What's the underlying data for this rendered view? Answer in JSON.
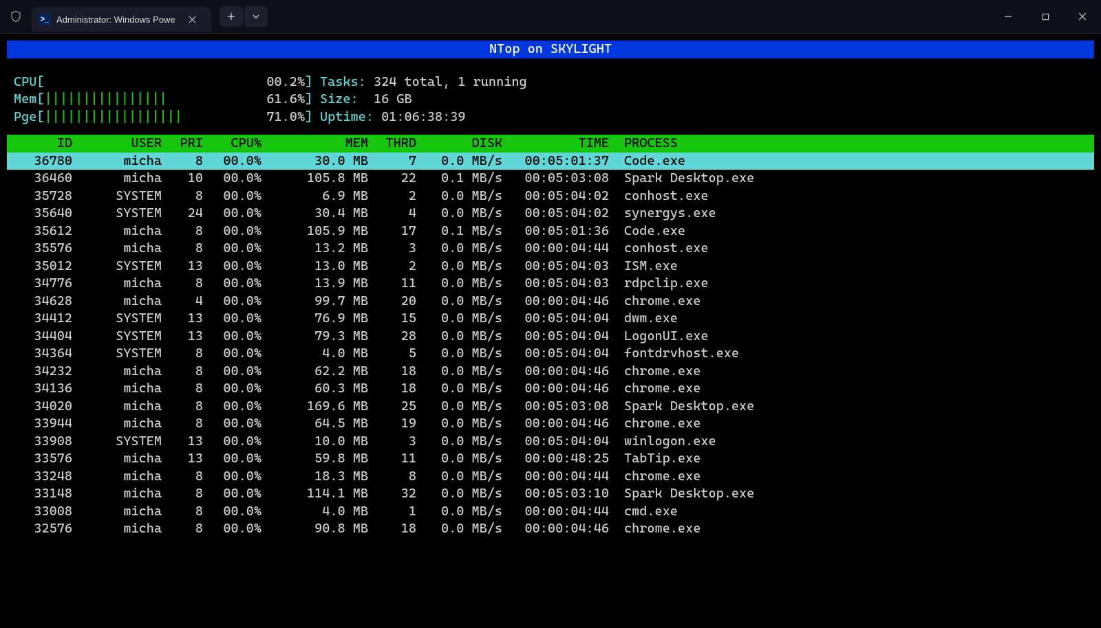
{
  "window": {
    "tab_title": "Administrator: Windows Powe"
  },
  "banner_text": "NTop on SKYLIGHT",
  "meters": {
    "cpu": {
      "label": "CPU",
      "bars": "",
      "pct": "00.2%"
    },
    "mem": {
      "label": "Mem",
      "bars": "||||||||||||||||",
      "pct": "61.6%"
    },
    "pge": {
      "label": "Pge",
      "bars": "||||||||||||||||||",
      "pct": "71.0%"
    }
  },
  "stats": {
    "tasks_label": "Tasks:",
    "tasks_value": "324 total, 1 running",
    "size_label": "Size:",
    "size_value": "16 GB",
    "uptime_label": "Uptime:",
    "uptime_value": "01:06:38:39"
  },
  "columns": {
    "id": "ID",
    "user": "USER",
    "pri": "PRI",
    "cpu": "CPU%",
    "mem": "MEM",
    "thrd": "THRD",
    "disk": "DISK",
    "time": "TIME",
    "process": "PROCESS"
  },
  "rows": [
    {
      "id": "36780",
      "user": "micha",
      "pri": "8",
      "cpu": "00.0%",
      "mem": "30.0 MB",
      "thrd": "7",
      "disk": "0.0 MB/s",
      "time": "00:05:01:37",
      "proc": "Code.exe",
      "selected": true
    },
    {
      "id": "36460",
      "user": "micha",
      "pri": "10",
      "cpu": "00.0%",
      "mem": "105.8 MB",
      "thrd": "22",
      "disk": "0.1 MB/s",
      "time": "00:05:03:08",
      "proc": "Spark Desktop.exe"
    },
    {
      "id": "35728",
      "user": "SYSTEM",
      "pri": "8",
      "cpu": "00.0%",
      "mem": "6.9 MB",
      "thrd": "2",
      "disk": "0.0 MB/s",
      "time": "00:05:04:02",
      "proc": "conhost.exe"
    },
    {
      "id": "35640",
      "user": "SYSTEM",
      "pri": "24",
      "cpu": "00.0%",
      "mem": "30.4 MB",
      "thrd": "4",
      "disk": "0.0 MB/s",
      "time": "00:05:04:02",
      "proc": "synergys.exe"
    },
    {
      "id": "35612",
      "user": "micha",
      "pri": "8",
      "cpu": "00.0%",
      "mem": "105.9 MB",
      "thrd": "17",
      "disk": "0.1 MB/s",
      "time": "00:05:01:36",
      "proc": "Code.exe"
    },
    {
      "id": "35576",
      "user": "micha",
      "pri": "8",
      "cpu": "00.0%",
      "mem": "13.2 MB",
      "thrd": "3",
      "disk": "0.0 MB/s",
      "time": "00:00:04:44",
      "proc": "conhost.exe"
    },
    {
      "id": "35012",
      "user": "SYSTEM",
      "pri": "13",
      "cpu": "00.0%",
      "mem": "13.0 MB",
      "thrd": "2",
      "disk": "0.0 MB/s",
      "time": "00:05:04:03",
      "proc": "ISM.exe"
    },
    {
      "id": "34776",
      "user": "micha",
      "pri": "8",
      "cpu": "00.0%",
      "mem": "13.9 MB",
      "thrd": "11",
      "disk": "0.0 MB/s",
      "time": "00:05:04:03",
      "proc": "rdpclip.exe"
    },
    {
      "id": "34628",
      "user": "micha",
      "pri": "4",
      "cpu": "00.0%",
      "mem": "99.7 MB",
      "thrd": "20",
      "disk": "0.0 MB/s",
      "time": "00:00:04:46",
      "proc": "chrome.exe"
    },
    {
      "id": "34412",
      "user": "SYSTEM",
      "pri": "13",
      "cpu": "00.0%",
      "mem": "76.9 MB",
      "thrd": "15",
      "disk": "0.0 MB/s",
      "time": "00:05:04:04",
      "proc": "dwm.exe"
    },
    {
      "id": "34404",
      "user": "SYSTEM",
      "pri": "13",
      "cpu": "00.0%",
      "mem": "79.3 MB",
      "thrd": "28",
      "disk": "0.0 MB/s",
      "time": "00:05:04:04",
      "proc": "LogonUI.exe"
    },
    {
      "id": "34364",
      "user": "SYSTEM",
      "pri": "8",
      "cpu": "00.0%",
      "mem": "4.0 MB",
      "thrd": "5",
      "disk": "0.0 MB/s",
      "time": "00:05:04:04",
      "proc": "fontdrvhost.exe"
    },
    {
      "id": "34232",
      "user": "micha",
      "pri": "8",
      "cpu": "00.0%",
      "mem": "62.2 MB",
      "thrd": "18",
      "disk": "0.0 MB/s",
      "time": "00:00:04:46",
      "proc": "chrome.exe"
    },
    {
      "id": "34136",
      "user": "micha",
      "pri": "8",
      "cpu": "00.0%",
      "mem": "60.3 MB",
      "thrd": "18",
      "disk": "0.0 MB/s",
      "time": "00:00:04:46",
      "proc": "chrome.exe"
    },
    {
      "id": "34020",
      "user": "micha",
      "pri": "8",
      "cpu": "00.0%",
      "mem": "169.6 MB",
      "thrd": "25",
      "disk": "0.0 MB/s",
      "time": "00:05:03:08",
      "proc": "Spark Desktop.exe"
    },
    {
      "id": "33944",
      "user": "micha",
      "pri": "8",
      "cpu": "00.0%",
      "mem": "64.5 MB",
      "thrd": "19",
      "disk": "0.0 MB/s",
      "time": "00:00:04:46",
      "proc": "chrome.exe"
    },
    {
      "id": "33908",
      "user": "SYSTEM",
      "pri": "13",
      "cpu": "00.0%",
      "mem": "10.0 MB",
      "thrd": "3",
      "disk": "0.0 MB/s",
      "time": "00:05:04:04",
      "proc": "winlogon.exe"
    },
    {
      "id": "33576",
      "user": "micha",
      "pri": "13",
      "cpu": "00.0%",
      "mem": "59.8 MB",
      "thrd": "11",
      "disk": "0.0 MB/s",
      "time": "00:00:48:25",
      "proc": "TabTip.exe"
    },
    {
      "id": "33248",
      "user": "micha",
      "pri": "8",
      "cpu": "00.0%",
      "mem": "18.3 MB",
      "thrd": "8",
      "disk": "0.0 MB/s",
      "time": "00:00:04:44",
      "proc": "chrome.exe"
    },
    {
      "id": "33148",
      "user": "micha",
      "pri": "8",
      "cpu": "00.0%",
      "mem": "114.1 MB",
      "thrd": "32",
      "disk": "0.0 MB/s",
      "time": "00:05:03:10",
      "proc": "Spark Desktop.exe"
    },
    {
      "id": "33008",
      "user": "micha",
      "pri": "8",
      "cpu": "00.0%",
      "mem": "4.0 MB",
      "thrd": "1",
      "disk": "0.0 MB/s",
      "time": "00:00:04:44",
      "proc": "cmd.exe"
    },
    {
      "id": "32576",
      "user": "micha",
      "pri": "8",
      "cpu": "00.0%",
      "mem": "90.8 MB",
      "thrd": "18",
      "disk": "0.0 MB/s",
      "time": "00:00:04:46",
      "proc": "chrome.exe"
    }
  ]
}
